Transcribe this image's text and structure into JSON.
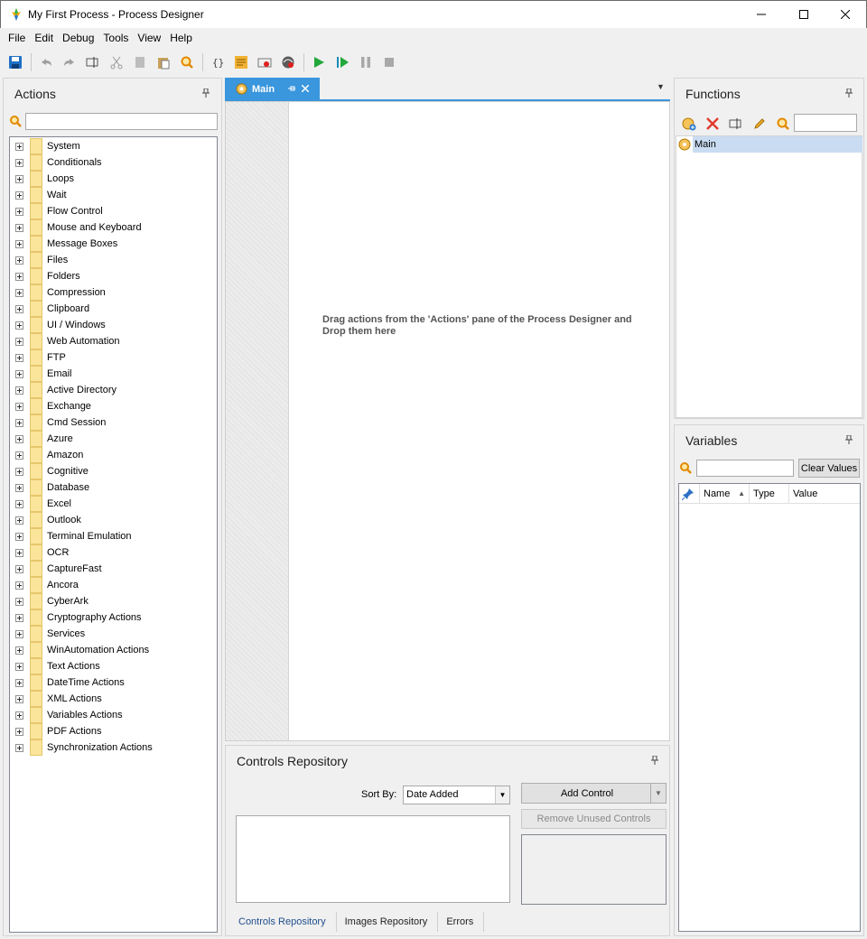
{
  "window": {
    "title": "My First Process - Process Designer",
    "minimize": "—",
    "maximize": "☐",
    "close": "✕"
  },
  "menu": [
    "File",
    "Edit",
    "Debug",
    "Tools",
    "View",
    "Help"
  ],
  "toolbar": {
    "buttons": [
      "save-icon",
      "undo-icon",
      "redo-icon",
      "rename-icon",
      "cut-icon",
      "copy-icon",
      "paste-icon",
      "find-icon",
      "variables-icon",
      "notes-icon",
      "record-icon",
      "web-recorder-icon",
      "run-icon",
      "run-next-icon",
      "pause-icon",
      "stop-icon"
    ]
  },
  "actions_panel": {
    "title": "Actions",
    "search_value": "",
    "items": [
      "System",
      "Conditionals",
      "Loops",
      "Wait",
      "Flow Control",
      "Mouse and Keyboard",
      "Message Boxes",
      "Files",
      "Folders",
      "Compression",
      "Clipboard",
      "UI / Windows",
      "Web Automation",
      "FTP",
      "Email",
      "Active Directory",
      "Exchange",
      "Cmd Session",
      "Azure",
      "Amazon",
      "Cognitive",
      "Database",
      "Excel",
      "Outlook",
      "Terminal Emulation",
      "OCR",
      "CaptureFast",
      "Ancora",
      "CyberArk",
      "Cryptography Actions",
      "Services",
      "WinAutomation Actions",
      "Text Actions",
      "DateTime Actions",
      "XML Actions",
      "Variables Actions",
      "PDF Actions",
      "Synchronization Actions"
    ]
  },
  "designer": {
    "tab_label": "Main",
    "drop_hint": "Drag actions from the 'Actions' pane of the Process Designer and Drop them here"
  },
  "controls_repository": {
    "title": "Controls Repository",
    "sort_label": "Sort By:",
    "sort_value": "Date Added",
    "add_control": "Add Control",
    "remove_unused": "Remove Unused Controls",
    "tabs": [
      "Controls Repository",
      "Images Repository",
      "Errors"
    ]
  },
  "functions_panel": {
    "title": "Functions",
    "search_value": "",
    "items": [
      "Main"
    ]
  },
  "variables_panel": {
    "title": "Variables",
    "search_value": "",
    "clear_button": "Clear Values",
    "columns": [
      "Name",
      "Type",
      "Value"
    ]
  },
  "colors": {
    "accent": "#3a96dd",
    "selection": "#c9dcf2",
    "folder": "#fbe59b"
  }
}
